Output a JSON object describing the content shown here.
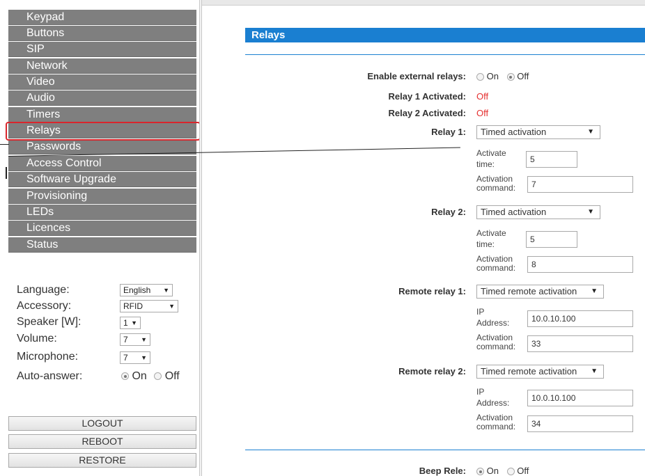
{
  "sidebar": {
    "menu": [
      {
        "label": "Keypad"
      },
      {
        "label": "Buttons"
      },
      {
        "label": "SIP"
      },
      {
        "label": "Network"
      },
      {
        "label": "Video"
      },
      {
        "label": "Audio"
      },
      {
        "label": "Timers"
      },
      {
        "label": "Relays",
        "active": true
      },
      {
        "label": "Passwords"
      },
      {
        "label": "Access Control"
      },
      {
        "label": "Software Upgrade"
      },
      {
        "label": "Provisioning"
      },
      {
        "label": "LEDs"
      },
      {
        "label": "Licences"
      },
      {
        "label": "Status"
      }
    ],
    "settings": {
      "language": {
        "label": "Language:",
        "value": "English"
      },
      "accessory": {
        "label": "Accessory:",
        "value": "RFID"
      },
      "speaker": {
        "label": "Speaker [W]:",
        "value": "1"
      },
      "volume": {
        "label": "Volume:",
        "value": "7"
      },
      "microphone": {
        "label": "Microphone:",
        "value": "7"
      },
      "auto_answer": {
        "label": "Auto-answer:",
        "on": "On",
        "off": "Off",
        "selected": "On"
      }
    },
    "buttons": {
      "logout": "LOGOUT",
      "reboot": "REBOOT",
      "restore": "RESTORE"
    }
  },
  "main": {
    "section_title": "Relays",
    "enable_external_relays": {
      "label": "Enable external relays:",
      "on": "On",
      "off": "Off",
      "selected": "Off"
    },
    "relay1_activated": {
      "label": "Relay 1 Activated:",
      "value": "Off"
    },
    "relay2_activated": {
      "label": "Relay 2 Activated:",
      "value": "Off"
    },
    "relay1": {
      "label": "Relay 1:",
      "mode": "Timed activation",
      "activate_time_label_1": "Activate",
      "activate_time_label_2": "time:",
      "activate_time": "5",
      "activation_command_label_1": "Activation",
      "activation_command_label_2": "command:",
      "activation_command": "7"
    },
    "relay2": {
      "label": "Relay 2:",
      "mode": "Timed activation",
      "activate_time_label_1": "Activate",
      "activate_time_label_2": "time:",
      "activate_time": "5",
      "activation_command_label_1": "Activation",
      "activation_command_label_2": "command:",
      "activation_command": "8"
    },
    "remote_relay1": {
      "label": "Remote relay 1:",
      "mode": "Timed remote activation",
      "ip_label_1": "IP",
      "ip_label_2": "Address:",
      "ip": "10.0.10.100",
      "activation_command_label_1": "Activation",
      "activation_command_label_2": "command:",
      "activation_command": "33"
    },
    "remote_relay2": {
      "label": "Remote relay 2:",
      "mode": "Timed remote activation",
      "ip_label_1": "IP",
      "ip_label_2": "Address:",
      "ip": "10.0.10.100",
      "activation_command_label_1": "Activation",
      "activation_command_label_2": "command:",
      "activation_command": "34"
    },
    "beep_rele": {
      "label": "Beep Rele:",
      "on": "On",
      "off": "Off",
      "selected": "On"
    }
  },
  "colors": {
    "accent": "#1a7fd1",
    "menu_bg": "#7f7f7f",
    "highlight": "#d9262c",
    "status_off": "#e53030"
  }
}
